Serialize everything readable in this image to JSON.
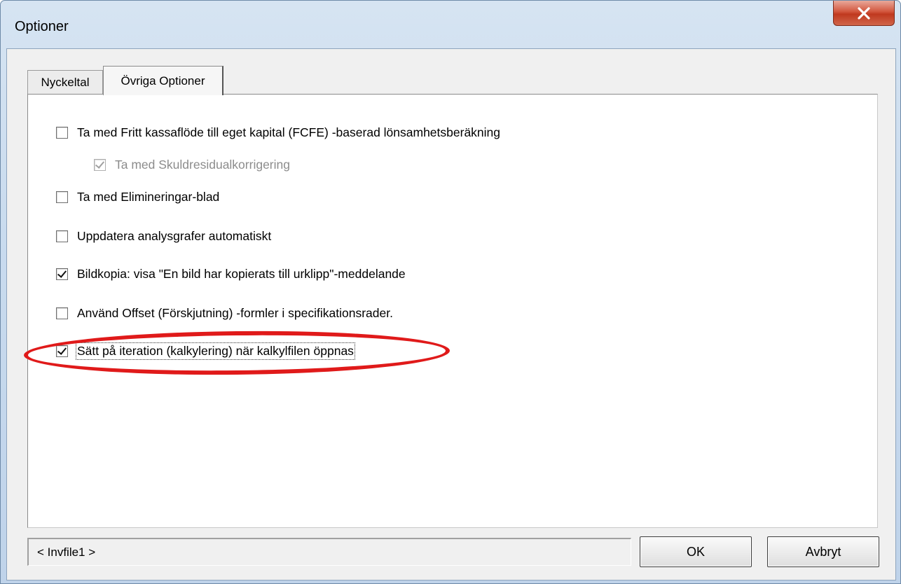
{
  "window": {
    "title": "Optioner",
    "close_glyph": "X"
  },
  "tabs": [
    {
      "label": "Nyckeltal",
      "selected": false
    },
    {
      "label": "Övriga Optioner",
      "selected": true
    }
  ],
  "options": [
    {
      "label": "Ta med Fritt kassaflöde till eget kapital (FCFE) -baserad lönsamhetsberäkning",
      "checked": false,
      "enabled": true
    },
    {
      "label": "Ta med Skuldresidualkorrigering",
      "checked": true,
      "enabled": false
    },
    {
      "label": "Ta med Elimineringar-blad",
      "checked": false,
      "enabled": true
    },
    {
      "label": "Uppdatera analysgrafer automatiskt",
      "checked": false,
      "enabled": true
    },
    {
      "label": "Bildkopia: visa \"En bild har kopierats till urklipp\"-meddelande",
      "checked": true,
      "enabled": true
    },
    {
      "label": "Använd Offset (Förskjutning) -formler i specifikationsrader.",
      "checked": false,
      "enabled": true
    },
    {
      "label": "Sätt på iteration (kalkylering) när kalkylfilen öppnas",
      "checked": true,
      "enabled": true
    }
  ],
  "annotation": {
    "color": "#e01a1a"
  },
  "footer": {
    "status": "< Invfile1 >",
    "ok_label": "OK",
    "cancel_label": "Avbryt"
  }
}
